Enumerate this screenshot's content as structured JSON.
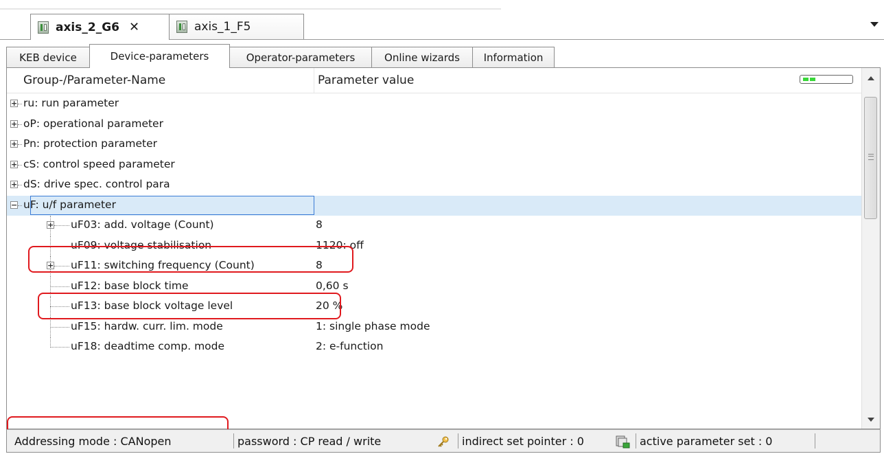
{
  "document_tabs": [
    {
      "label": "axis_2_G6",
      "active": true,
      "closable": true
    },
    {
      "label": "axis_1_F5",
      "active": false,
      "closable": false
    }
  ],
  "view_tabs": [
    {
      "label": "KEB device",
      "active": false
    },
    {
      "label": "Device-parameters",
      "active": true
    },
    {
      "label": "Operator-parameters",
      "active": false
    },
    {
      "label": "Online wizards",
      "active": false
    },
    {
      "label": "Information",
      "active": false
    }
  ],
  "columns": {
    "name": "Group-/Parameter-Name",
    "value": "Parameter value"
  },
  "rows": [
    {
      "name": "ru: run parameter",
      "value": "",
      "level": 0,
      "expander": "+"
    },
    {
      "name": "oP: operational parameter",
      "value": "",
      "level": 0,
      "expander": "+"
    },
    {
      "name": "Pn: protection parameter",
      "value": "",
      "level": 0,
      "expander": "+"
    },
    {
      "name": "cS: control speed parameter",
      "value": "",
      "level": 0,
      "expander": "+"
    },
    {
      "name": "dS: drive spec. control para",
      "value": "",
      "level": 0,
      "expander": "+"
    },
    {
      "name": "uF: u/f parameter",
      "value": "",
      "level": 0,
      "expander": "-",
      "selected": true
    },
    {
      "name": "uF03: add. voltage (Count)",
      "value": "8",
      "level": 1,
      "expander": "+",
      "highlighted": true
    },
    {
      "name": "uF09: voltage stabilisation",
      "value": "1120: off",
      "level": 1,
      "expander": ""
    },
    {
      "name": "uF11: switching frequency (Count)",
      "value": "8",
      "level": 1,
      "expander": "+",
      "highlighted": true
    },
    {
      "name": "uF12: base block time",
      "value": "0,60 s",
      "level": 1,
      "expander": ""
    },
    {
      "name": "uF13: base block voltage level",
      "value": "20 %",
      "level": 1,
      "expander": ""
    },
    {
      "name": "uF15: hardw. curr. lim. mode",
      "value": "1: single phase mode",
      "level": 1,
      "expander": ""
    },
    {
      "name": "uF18: deadtime comp. mode",
      "value": "2: e-function",
      "level": 1,
      "expander": ""
    }
  ],
  "status": {
    "addressing_mode": "Addressing mode  : CANopen",
    "password": "password : CP read / write",
    "indirect_set_pointer": "indirect set pointer  : 0",
    "active_parameter_set": "active parameter set  : 0"
  },
  "colors": {
    "selection": "#d9eaf8",
    "highlight_frame": "#e0191e",
    "led_green": "#39d739"
  },
  "icons": {
    "device_tab": "device-icon",
    "close": "close-icon",
    "dropdown": "chevron-down-icon",
    "password": "key-icon",
    "indirect_set": "parameter-set-icon"
  }
}
